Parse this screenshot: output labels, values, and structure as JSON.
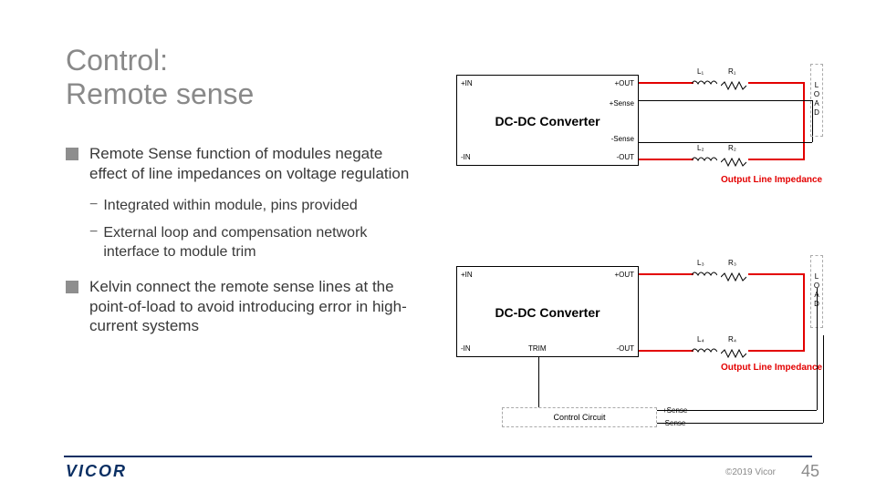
{
  "title_line1": "Control:",
  "title_line2": "Remote sense",
  "bullets": [
    {
      "text": "Remote Sense function of modules negate effect of line impedances on voltage regulation",
      "sub": [
        "Integrated within module, pins provided",
        "External loop and compensation network interface to module trim"
      ]
    },
    {
      "text": "Kelvin connect the remote sense lines at the point-of-load to avoid introducing error in high-current systems",
      "sub": []
    }
  ],
  "diagram": {
    "converter_label": "DC-DC Converter",
    "pins": {
      "pin_in": "+IN",
      "pin_out": "+OUT",
      "nin": "-IN",
      "nout": "-OUT",
      "psense": "+Sense",
      "nsense": "-Sense",
      "trim": "TRIM"
    },
    "components": {
      "L1": "L₁",
      "R1": "R₁",
      "L2": "L₂",
      "R2": "R₂",
      "L3": "L₃",
      "R3": "R₃",
      "L4": "L₄",
      "R4": "R₄"
    },
    "load_label": "LOAD",
    "output_line_impedance": "Output Line Impedance",
    "control_circuit": "Control Circuit",
    "psense2": "+Sense",
    "nsense2": "-Sense"
  },
  "footer": {
    "logo": "VICOR",
    "copyright": "©2019 Vicor",
    "page": "45"
  }
}
